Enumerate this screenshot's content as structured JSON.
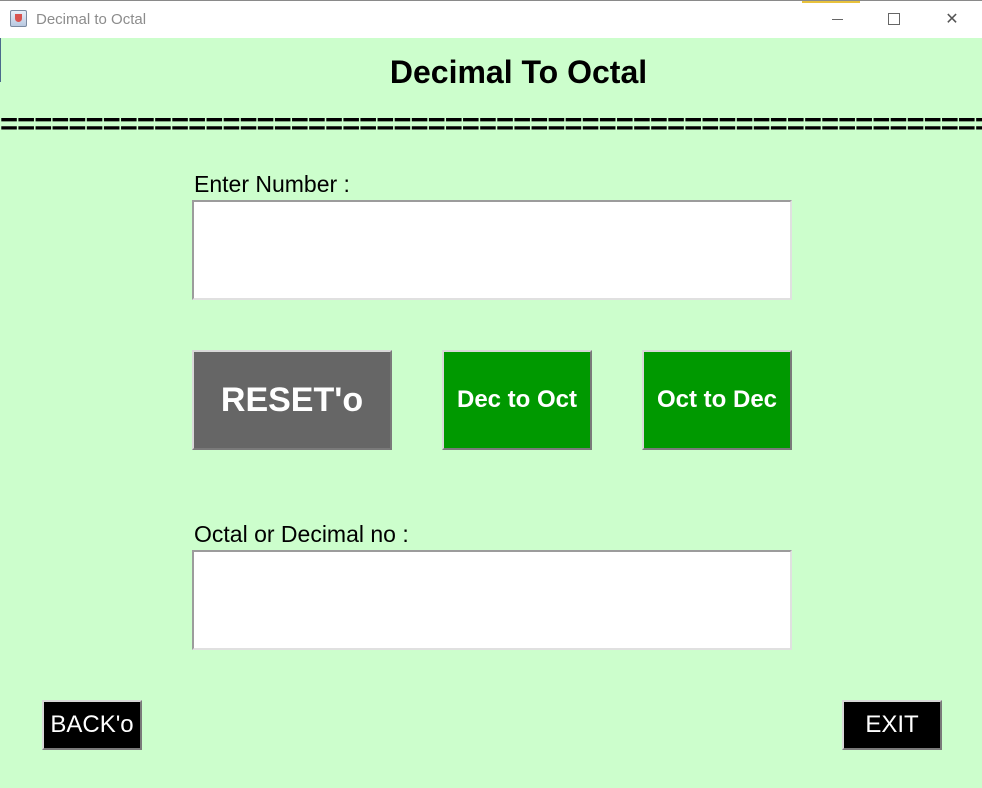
{
  "window": {
    "title": "Decimal to Octal",
    "controls": {
      "minimize": "—",
      "maximize": "",
      "close": "✕"
    }
  },
  "main": {
    "heading": "Decimal To Octal",
    "divider": "=================================================================",
    "input": {
      "label": "Enter Number :",
      "value": "",
      "placeholder": ""
    },
    "buttons": {
      "reset": "RESET'o",
      "dec_to_oct": "Dec to Oct",
      "oct_to_dec": "Oct to Dec"
    },
    "output": {
      "label": "Octal or Decimal no :",
      "value": "",
      "placeholder": ""
    }
  },
  "footer": {
    "back": "BACK'o",
    "exit": "EXIT"
  },
  "colors": {
    "background": "#ccfecc",
    "reset_button": "#666666",
    "convert_button": "#009900",
    "nav_button": "#000000"
  }
}
